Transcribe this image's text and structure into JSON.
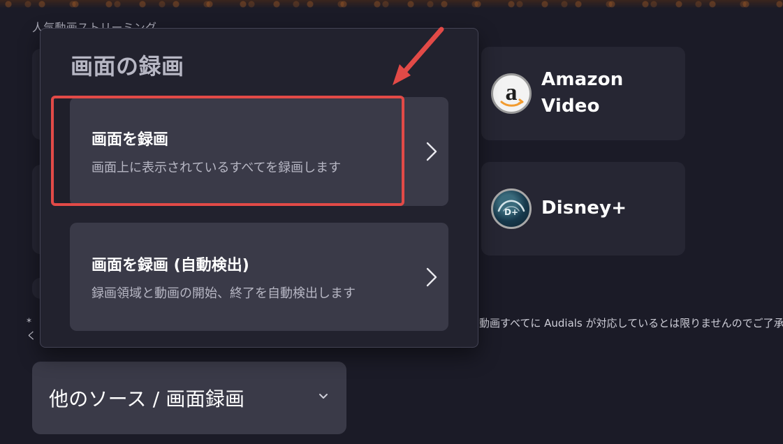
{
  "background": {
    "section_title": "人気動画ストリーミング",
    "services": [
      {
        "name": "Amazon Video",
        "logo_icon": "amazon-logo-icon"
      },
      {
        "name": "Disney+",
        "logo_icon": "disney-plus-logo-icon"
      }
    ],
    "footnote_prefix": "*",
    "footnote_line2_prefix": "く",
    "footnote_right": "動画すべてに Audials が対応しているとは限りませんのでご了承",
    "source_dropdown": {
      "label": "他のソース / 画面録画",
      "icon": "chevron-down-icon"
    }
  },
  "modal": {
    "title": "画面の録画",
    "options": [
      {
        "title": "画面を録画",
        "description": "画面上に表示されているすべてを録画します",
        "icon": "chevron-right-icon"
      },
      {
        "title": "画面を録画 (自動検出)",
        "description": "録画領域と動画の開始、終了を自動検出します",
        "icon": "chevron-right-icon"
      }
    ]
  },
  "annotation": {
    "highlight_color": "#e24a47",
    "arrow_color": "#e24a47"
  },
  "colors": {
    "page_bg": "#1b1b27",
    "modal_bg": "#22222e",
    "card_bg": "#262633",
    "option_bg": "#3a3a48",
    "text_primary": "#ffffff",
    "text_muted": "#b7b7c4"
  }
}
